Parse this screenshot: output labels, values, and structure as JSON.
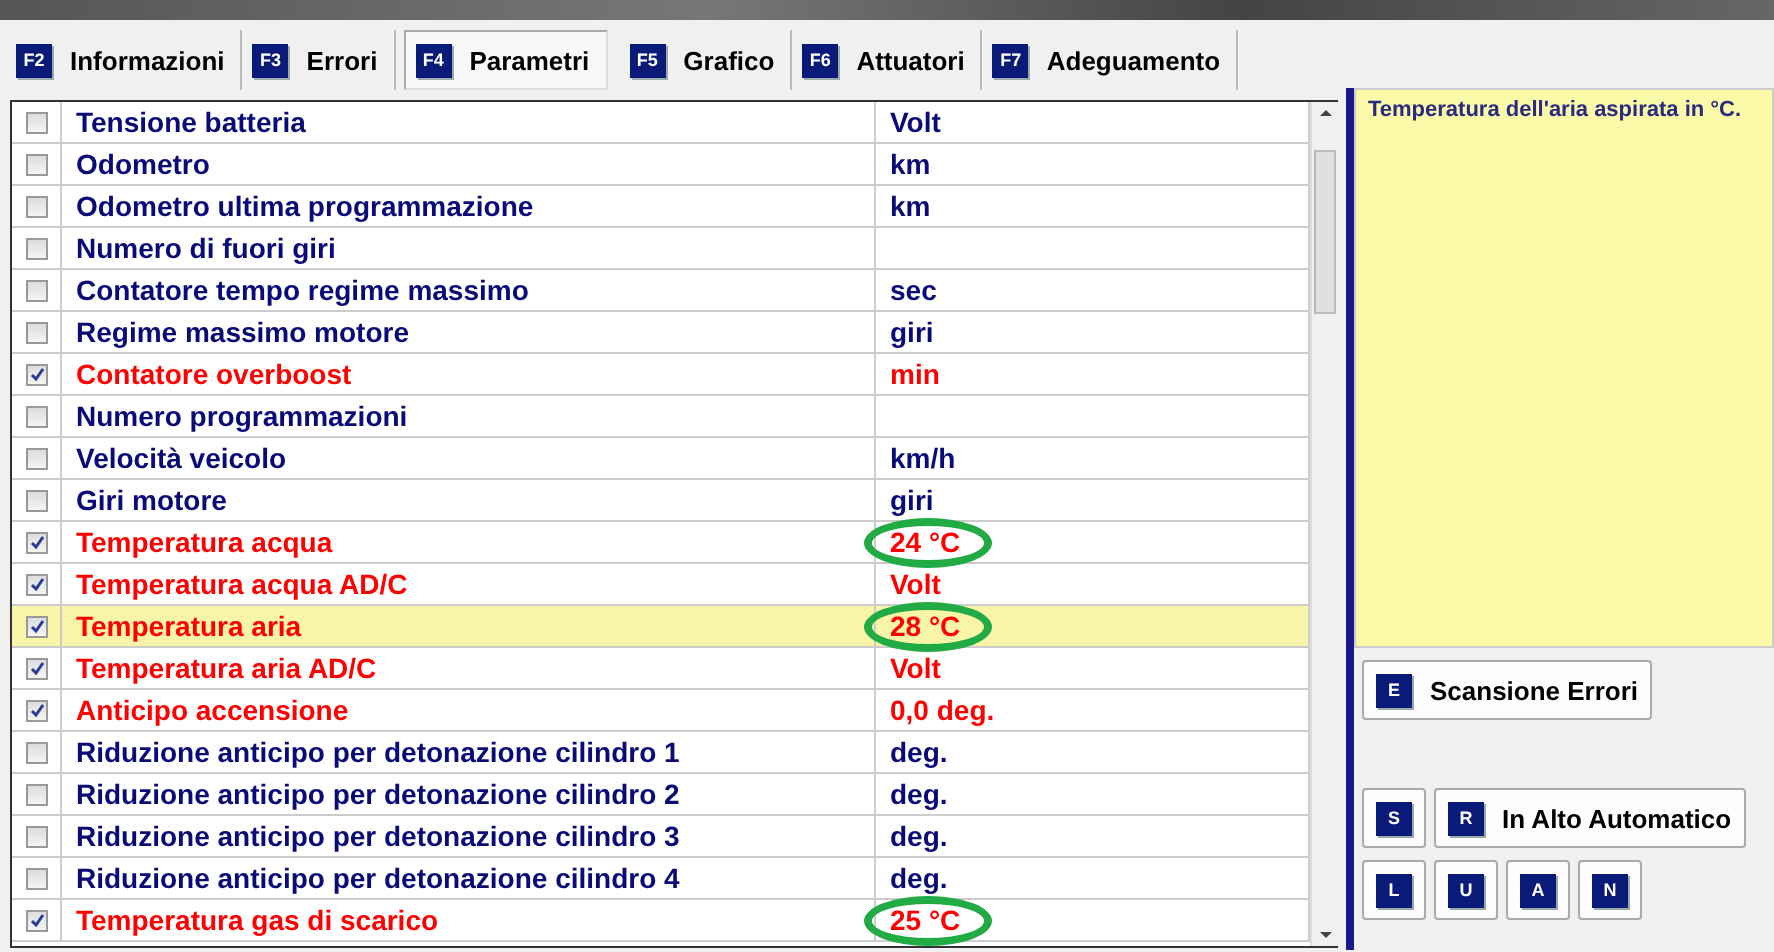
{
  "tabs": [
    {
      "key": "F2",
      "label": "Informazioni",
      "selected": false
    },
    {
      "key": "F3",
      "label": "Errori",
      "selected": false
    },
    {
      "key": "F4",
      "label": "Parametri",
      "selected": true
    },
    {
      "key": "F5",
      "label": "Grafico",
      "selected": false
    },
    {
      "key": "F6",
      "label": "Attuatori",
      "selected": false
    },
    {
      "key": "F7",
      "label": "Adeguamento",
      "selected": false
    }
  ],
  "parameters": [
    {
      "name": "Tensione batteria",
      "value": "Volt",
      "checked": false,
      "selected": false,
      "circled": false
    },
    {
      "name": "Odometro",
      "value": "km",
      "checked": false,
      "selected": false,
      "circled": false
    },
    {
      "name": "Odometro ultima programmazione",
      "value": "km",
      "checked": false,
      "selected": false,
      "circled": false
    },
    {
      "name": "Numero di fuori giri",
      "checked": false,
      "selected": false,
      "circled": false
    },
    {
      "name": "Contatore tempo regime massimo",
      "value": "sec",
      "checked": false,
      "selected": false,
      "circled": false
    },
    {
      "name": "Regime massimo motore",
      "value": "giri",
      "checked": false,
      "selected": false,
      "circled": false
    },
    {
      "name": "Contatore overboost",
      "value": "min",
      "checked": true,
      "selected": false,
      "circled": false
    },
    {
      "name": "Numero programmazioni",
      "checked": false,
      "selected": false,
      "circled": false
    },
    {
      "name": "Velocità veicolo",
      "value": "km/h",
      "checked": false,
      "selected": false,
      "circled": false
    },
    {
      "name": "Giri motore",
      "value": "giri",
      "checked": false,
      "selected": false,
      "circled": false
    },
    {
      "name": "Temperatura acqua",
      "value": "24 °C",
      "checked": true,
      "selected": false,
      "circled": true
    },
    {
      "name": "Temperatura acqua AD/C",
      "value": "Volt",
      "checked": true,
      "selected": false,
      "circled": false
    },
    {
      "name": "Temperatura aria",
      "value": "28 °C",
      "checked": true,
      "selected": true,
      "circled": true
    },
    {
      "name": "Temperatura aria AD/C",
      "value": "Volt",
      "checked": true,
      "selected": false,
      "circled": false
    },
    {
      "name": "Anticipo accensione",
      "value": "0,0 deg.",
      "checked": true,
      "selected": false,
      "circled": false
    },
    {
      "name": "Riduzione anticipo per detonazione cilindro 1",
      "value": "deg.",
      "checked": false,
      "selected": false,
      "circled": false
    },
    {
      "name": "Riduzione anticipo per detonazione cilindro 2",
      "value": "deg.",
      "checked": false,
      "selected": false,
      "circled": false
    },
    {
      "name": "Riduzione anticipo per detonazione cilindro 3",
      "value": "deg.",
      "checked": false,
      "selected": false,
      "circled": false
    },
    {
      "name": "Riduzione anticipo per detonazione cilindro 4",
      "value": "deg.",
      "checked": false,
      "selected": false,
      "circled": false
    },
    {
      "name": "Temperatura gas di scarico",
      "value": "25 °C",
      "checked": true,
      "selected": false,
      "circled": true
    }
  ],
  "description": "Temperatura dell'aria aspirata in °C.",
  "scan_button": {
    "key": "E",
    "label": "Scansione Errori"
  },
  "auto_row": [
    {
      "key": "S"
    },
    {
      "key": "R",
      "label": "In Alto Automatico"
    }
  ],
  "key_buttons": [
    {
      "key": "L"
    },
    {
      "key": "U"
    },
    {
      "key": "A"
    },
    {
      "key": "N"
    }
  ]
}
